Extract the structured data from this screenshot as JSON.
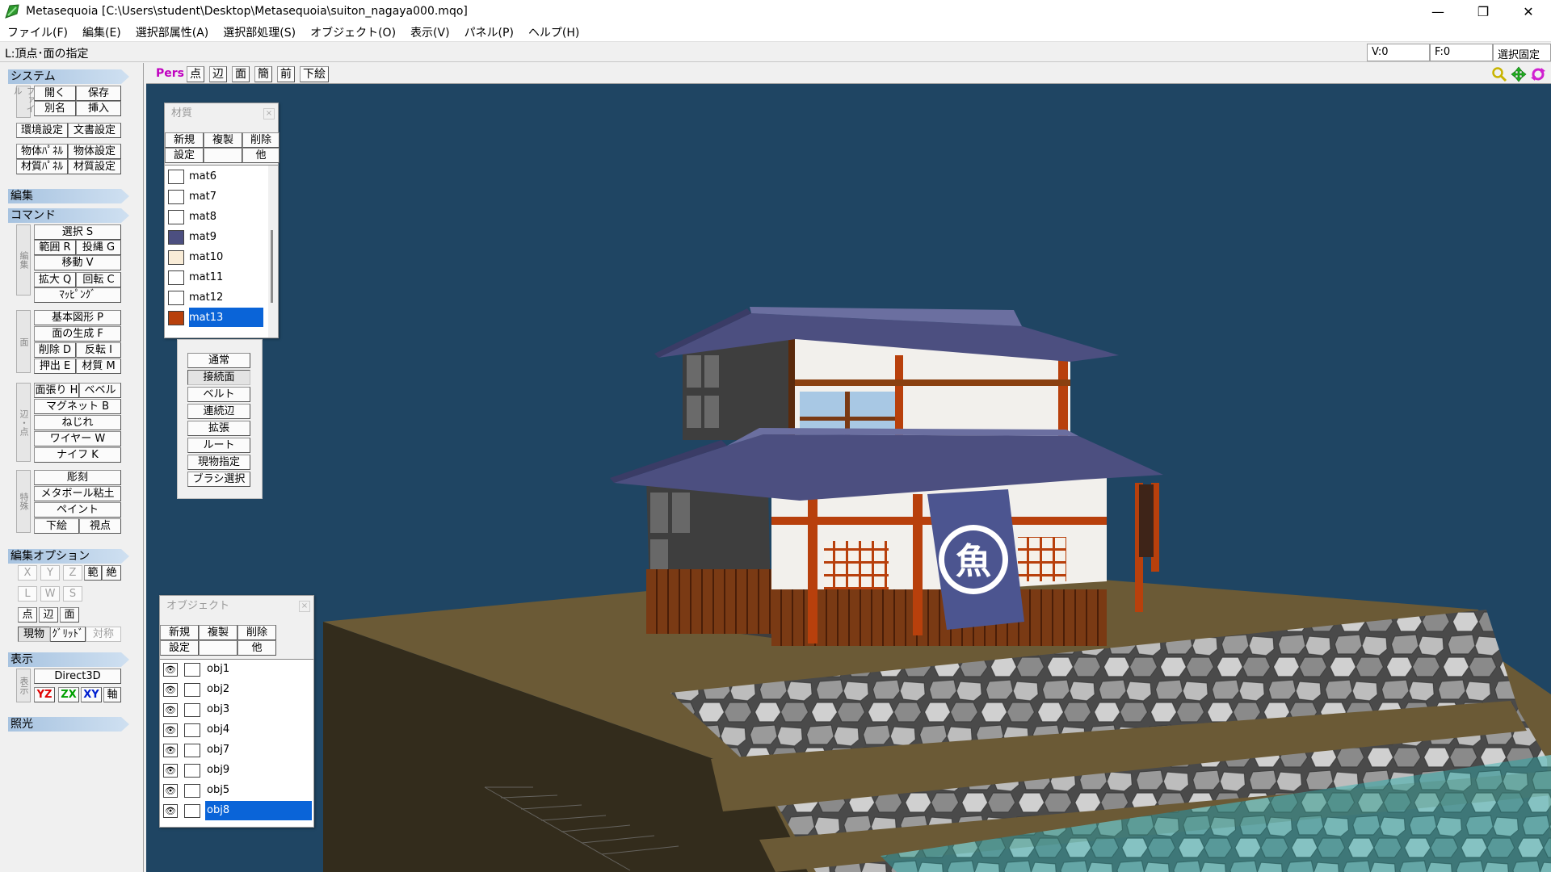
{
  "window": {
    "title": "Metasequoia [C:\\Users\\student\\Desktop\\Metasequoia\\suiton_nagaya000.mqo]",
    "minimize": "—",
    "restore": "❐",
    "close": "✕"
  },
  "menu": [
    "ファイル(F)",
    "編集(E)",
    "選択部属性(A)",
    "選択部処理(S)",
    "オブジェクト(O)",
    "表示(V)",
    "パネル(P)",
    "ヘルプ(H)"
  ],
  "status": {
    "mode": "L:頂点･面の指定",
    "vertices": "V:0",
    "faces": "F:0",
    "selection_lock": "選択固定"
  },
  "left": {
    "system": {
      "title": "システム",
      "side": "ファイル",
      "open": "開く",
      "save": "保存",
      "saveas": "別名",
      "insert": "挿入",
      "env": "環境設定",
      "docsettings": "文書設定",
      "objpanel": "物体ﾊﾟﾈﾙ",
      "objsettings": "物体設定",
      "matpanel": "材質ﾊﾟﾈﾙ",
      "matsettings": "材質設定"
    },
    "edit_title": "編集",
    "command": {
      "title": "コマンド",
      "side1": "編集",
      "side2": "面",
      "side3": "辺・点",
      "side4": "特殊",
      "select": "選択 S",
      "range": "範囲 R",
      "lasso": "投縄 G",
      "move": "移動 V",
      "scale": "拡大 Q",
      "rotate": "回転 C",
      "mapping": "ﾏｯﾋﾟﾝｸﾞ",
      "primitive": "基本図形 P",
      "makeface": "面の生成 F",
      "delete": "削除 D",
      "invert": "反転 I",
      "extrude": "押出 E",
      "material": "材質 M",
      "extend": "面張り H",
      "bevel": "ベベル",
      "magnet": "マグネット B",
      "twist": "ねじれ",
      "wire": "ワイヤー W",
      "knife": "ナイフ K",
      "sculpt": "彫刻",
      "metaball": "メタボール粘土",
      "paint": "ペイント",
      "underlay": "下絵",
      "view": "視点"
    },
    "editopt": {
      "title": "編集オプション",
      "x": "X",
      "y": "Y",
      "z": "Z",
      "range": "範",
      "abs": "絶",
      "l": "L",
      "w": "W",
      "s": "S",
      "point": "点",
      "edge": "辺",
      "face": "面",
      "current": "現物",
      "grid": "ｸﾞﾘｯﾄﾞ",
      "symmetry": "対称"
    },
    "display": {
      "title": "表示",
      "side": "表示",
      "renderer": "Direct3D",
      "yz": "YZ",
      "zx": "ZX",
      "xy": "XY",
      "axis": "軸"
    },
    "lighting_title": "照光"
  },
  "viewport": {
    "pers": "Pers",
    "point": "点",
    "edge": "辺",
    "face": "面",
    "simple": "簡",
    "front": "前",
    "underlay": "下絵"
  },
  "material_panel": {
    "title": "材質",
    "close": "×",
    "new": "新規",
    "copy": "複製",
    "delete": "削除",
    "settings": "設定",
    "other": "他",
    "items": [
      {
        "name": "mat6",
        "color": "#ffffff"
      },
      {
        "name": "mat7",
        "color": "#ffffff"
      },
      {
        "name": "mat8",
        "color": "#ffffff"
      },
      {
        "name": "mat9",
        "color": "#4c4f80"
      },
      {
        "name": "mat10",
        "color": "#f9ecd7"
      },
      {
        "name": "mat11",
        "color": "#ffffff"
      },
      {
        "name": "mat12",
        "color": "#ffffff"
      },
      {
        "name": "mat13",
        "color": "#b8400c"
      }
    ],
    "selected": "mat13"
  },
  "select_modes": [
    "通常",
    "接続面",
    "ベルト",
    "連続辺",
    "拡張",
    "ルート",
    "現物指定",
    "ブラシ選択"
  ],
  "object_panel": {
    "title": "オブジェクト",
    "close": "×",
    "new": "新規",
    "copy": "複製",
    "delete": "削除",
    "settings": "設定",
    "other": "他",
    "items": [
      "obj1",
      "obj2",
      "obj3",
      "obj4",
      "obj7",
      "obj9",
      "obj5",
      "obj8"
    ],
    "selected": "obj8"
  },
  "banner_kanji": "魚",
  "colors": {
    "viewport_bg": "#1f4563",
    "selection": "#0a64d8",
    "pers": "#c000c0"
  }
}
